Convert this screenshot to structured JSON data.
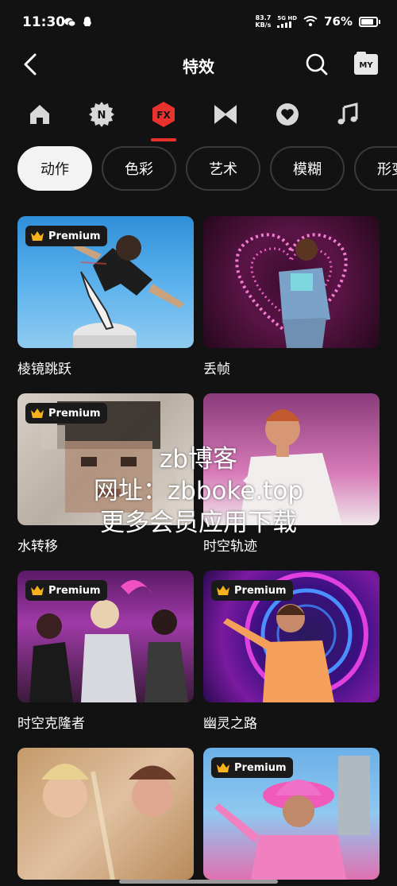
{
  "status": {
    "time": "11:30",
    "speed": "83.7",
    "speed_unit": "KB/s",
    "network": "5G HD",
    "battery": "76%"
  },
  "header": {
    "title": "特效",
    "my_label": "MY"
  },
  "categories": [
    {
      "icon": "home-icon"
    },
    {
      "icon": "new-badge-icon",
      "text": "N"
    },
    {
      "icon": "fx-icon",
      "text": "FX",
      "active": true
    },
    {
      "icon": "transition-bowtie-icon"
    },
    {
      "icon": "heart-icon"
    },
    {
      "icon": "music-note-icon"
    }
  ],
  "chips": [
    "动作",
    "色彩",
    "艺术",
    "模糊",
    "形变"
  ],
  "premium_label": "Premium",
  "effects": [
    {
      "label": "棱镜跳跃",
      "premium": true
    },
    {
      "label": "丢帧",
      "premium": false
    },
    {
      "label": "水转移",
      "premium": true
    },
    {
      "label": "时空轨迹",
      "premium": false
    },
    {
      "label": "时空克隆者",
      "premium": true
    },
    {
      "label": "幽灵之路",
      "premium": true
    },
    {
      "label": "",
      "premium": false
    },
    {
      "label": "",
      "premium": true
    }
  ],
  "watermark": {
    "line1": "zb博客",
    "line2": "网址：zbboke.top",
    "line3": "更多会员应用下载"
  },
  "colors": {
    "background": "#121212",
    "accent": "#e8322d",
    "chip_active": "#f3f3f3"
  }
}
